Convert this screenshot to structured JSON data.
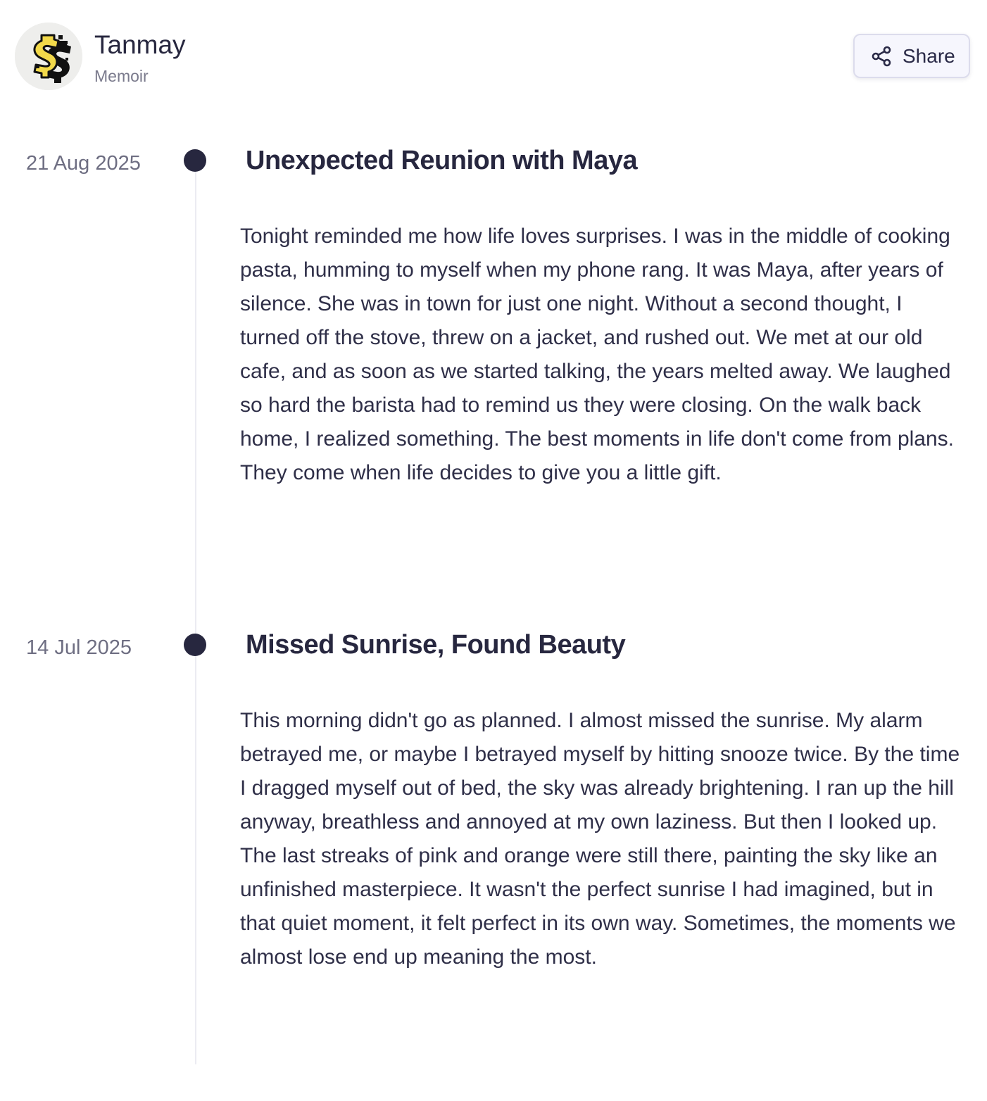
{
  "header": {
    "author_name": "Tanmay",
    "subtitle": "Memoir",
    "avatar_icon": "dollar-sign-sticker-icon",
    "share": {
      "label": "Share",
      "icon": "share-icon"
    }
  },
  "entries": [
    {
      "date": "21 Aug 2025",
      "title": "Unexpected Reunion with Maya",
      "body": "Tonight reminded me how life loves surprises. I was in the middle of cooking pasta, humming to myself when my phone rang. It was Maya, after years of silence. She was in town for just one night. Without a second thought, I turned off the stove, threw on a jacket, and rushed out. We met at our old cafe, and as soon as we started talking, the years melted away. We laughed so hard the barista had to remind us they were closing. On the walk back home, I realized something. The best moments in life don't come from plans. They come when life decides to give you a little gift."
    },
    {
      "date": "14 Jul 2025",
      "title": "Missed Sunrise, Found Beauty",
      "body": "This morning didn't go as planned. I almost missed the sunrise. My alarm betrayed me, or maybe I betrayed myself by hitting snooze twice. By the time I dragged myself out of bed, the sky was already brightening. I ran up the hill anyway, breathless and annoyed at my own laziness. But then I looked up. The last streaks of pink and orange were still there, painting the sky like an unfinished masterpiece. It wasn't the perfect sunrise I had imagined, but in that quiet moment, it felt perfect in its own way. Sometimes, the moments we almost lose end up meaning the most."
    }
  ],
  "colors": {
    "ink": "#27273f",
    "muted": "#6e6e82",
    "timeline": "#ececf2",
    "button_bg": "#f6f6fd",
    "button_border": "#dcdcec",
    "avatar_bg": "#eeeeec",
    "sticker_yellow": "#f2d94a"
  }
}
